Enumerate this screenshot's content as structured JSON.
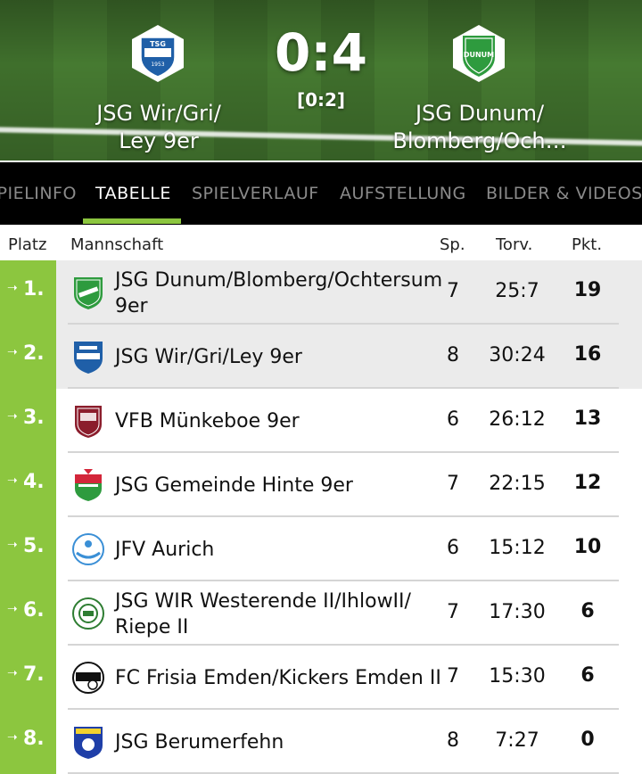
{
  "match": {
    "home_team": "JSG Wir/Gri/\nLey 9er",
    "away_team": "JSG Dunum/\nBlomberg/Och…",
    "score": "0:4",
    "halftime": "[0:2]",
    "home_crest_text": "TSG",
    "home_crest_year": "1953",
    "away_crest_text": "DUNUM"
  },
  "tabs": [
    {
      "label": "SPIELINFO",
      "active": false
    },
    {
      "label": "TABELLE",
      "active": true
    },
    {
      "label": "SPIELVERLAUF",
      "active": false
    },
    {
      "label": "AUFSTELLUNG",
      "active": false
    },
    {
      "label": "BILDER & VIDEOS",
      "active": false
    }
  ],
  "table": {
    "headers": {
      "platz": "Platz",
      "mannschaft": "Mannschaft",
      "sp": "Sp.",
      "torv": "Torv.",
      "pkt": "Pkt."
    },
    "rows": [
      {
        "platz": "1.",
        "team": "JSG Dunum/Blomberg/Ochtersum 9er",
        "sp": "7",
        "torv": "25:7",
        "pkt": "19",
        "logo": "dunum-crest-icon",
        "highlight": true
      },
      {
        "platz": "2.",
        "team": "JSG Wir/Gri/Ley 9er",
        "sp": "8",
        "torv": "30:24",
        "pkt": "16",
        "logo": "tsg-crest-icon",
        "highlight": true
      },
      {
        "platz": "3.",
        "team": "VFB Münkeboe 9er",
        "sp": "6",
        "torv": "26:12",
        "pkt": "13",
        "logo": "vfb-crest-icon",
        "highlight": false
      },
      {
        "platz": "4.",
        "team": "JSG Gemeinde Hinte 9er",
        "sp": "7",
        "torv": "22:15",
        "pkt": "12",
        "logo": "hinte-crest-icon",
        "highlight": false
      },
      {
        "platz": "5.",
        "team": "JFV Aurich",
        "sp": "6",
        "torv": "15:12",
        "pkt": "10",
        "logo": "jfv-aurich-crest-icon",
        "highlight": false
      },
      {
        "platz": "6.",
        "team": "JSG WIR Westerende II/IhlowII/ Riepe II",
        "sp": "7",
        "torv": "17:30",
        "pkt": "6",
        "logo": "sv-eintracht-crest-icon",
        "highlight": false
      },
      {
        "platz": "7.",
        "team": "FC Frisia Emden/Kickers Emden II",
        "sp": "7",
        "torv": "15:30",
        "pkt": "6",
        "logo": "fc-frisia-crest-icon",
        "highlight": false
      },
      {
        "platz": "8.",
        "team": "JSG Berumerfehn",
        "sp": "8",
        "torv": "7:27",
        "pkt": "0",
        "logo": "berumerfehn-crest-icon",
        "highlight": false
      }
    ]
  },
  "colors": {
    "accent": "#8cc63f",
    "highlight_row": "#ebebeb",
    "tab_bar": "#000000"
  }
}
